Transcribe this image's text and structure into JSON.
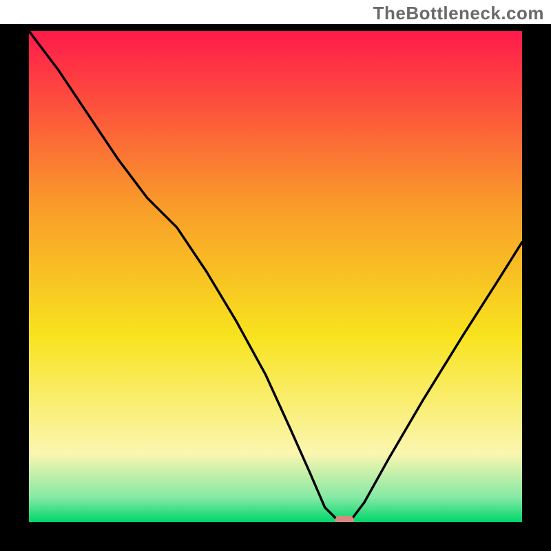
{
  "watermark": "TheBottleneck.com",
  "chart_data": {
    "type": "line",
    "title": "",
    "xlabel": "",
    "ylabel": "",
    "xlim": [
      0,
      100
    ],
    "ylim": [
      0,
      100
    ],
    "grid": false,
    "x": [
      0,
      6,
      12,
      18,
      24,
      30,
      36,
      42,
      48,
      53,
      57,
      60,
      63,
      65,
      68,
      73,
      80,
      88,
      95,
      100
    ],
    "values": [
      100,
      92,
      83,
      74,
      66,
      60,
      51,
      41,
      30,
      19,
      10,
      3,
      0,
      0,
      4,
      13,
      25,
      38,
      49,
      57
    ],
    "marker": {
      "x": 64,
      "y": 0
    },
    "gradient": {
      "top": "#FF1A4B",
      "mid_upper": "#F99A2A",
      "mid": "#F8E31E",
      "mid_lower": "#FBF6B0",
      "lower": "#84E9A4",
      "bottom": "#00D66A"
    }
  }
}
